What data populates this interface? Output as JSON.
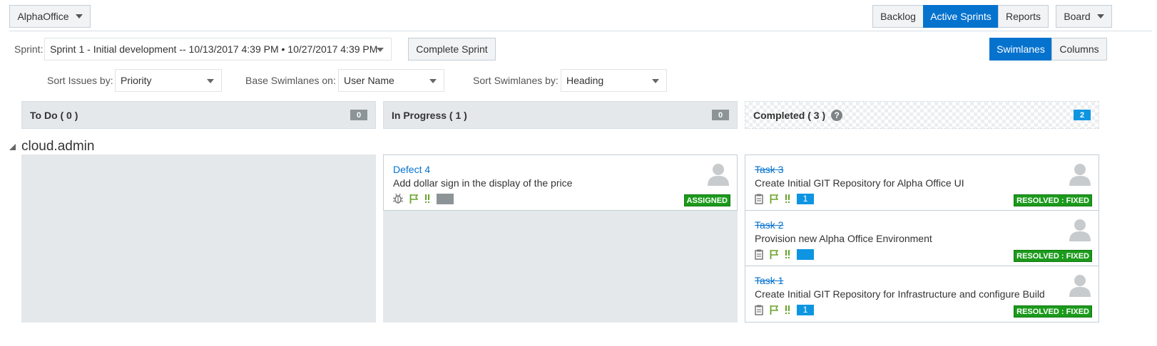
{
  "project": {
    "name": "AlphaOffice"
  },
  "view_tabs": [
    {
      "label": "Backlog",
      "active": false
    },
    {
      "label": "Active Sprints",
      "active": true
    },
    {
      "label": "Reports",
      "active": false
    }
  ],
  "board_menu": {
    "label": "Board"
  },
  "sprint": {
    "label": "Sprint:",
    "selected": "Sprint 1 - Initial development -- 10/13/2017 4:39 PM • 10/27/2017 4:39 PM",
    "complete_label": "Complete Sprint"
  },
  "layout_toggle": [
    {
      "label": "Swimlanes",
      "active": true
    },
    {
      "label": "Columns",
      "active": false
    }
  ],
  "filters": {
    "sort_issues_label": "Sort Issues by:",
    "sort_issues_value": "Priority",
    "base_swimlanes_label": "Base Swimlanes on:",
    "base_swimlanes_value": "User Name",
    "sort_swimlanes_label": "Sort Swimlanes by:",
    "sort_swimlanes_value": "Heading"
  },
  "columns": [
    {
      "title": "To Do ( 0 )",
      "count": "0"
    },
    {
      "title": "In Progress ( 1 )",
      "count": "0"
    },
    {
      "title": "Completed ( 3 )",
      "count": "2"
    }
  ],
  "swimlane": {
    "name": "cloud.admin"
  },
  "cards": {
    "in_progress": [
      {
        "key": "Defect 4",
        "title": "Add dollar sign in the display of the price",
        "points": "",
        "status": "ASSIGNED",
        "type_icon": "bug-icon"
      }
    ],
    "completed": [
      {
        "key": "Task 3",
        "title": "Create Initial GIT Repository for Alpha Office UI",
        "points": "1",
        "status": "RESOLVED : FIXED",
        "type_icon": "task-icon"
      },
      {
        "key": "Task 2",
        "title": "Provision new Alpha Office Environment",
        "points": "",
        "status": "RESOLVED : FIXED",
        "type_icon": "task-icon"
      },
      {
        "key": "Task 1",
        "title": "Create Initial GIT Repository for Infrastructure and configure Build",
        "points": "1",
        "status": "RESOLVED : FIXED",
        "type_icon": "task-icon"
      }
    ]
  },
  "colors": {
    "primary": "#0572ce",
    "status_green": "#1b9a1b",
    "points_blue": "#0e95e2",
    "flag_green": "#6aa32a",
    "lane_grey": "#e4e8ea"
  }
}
